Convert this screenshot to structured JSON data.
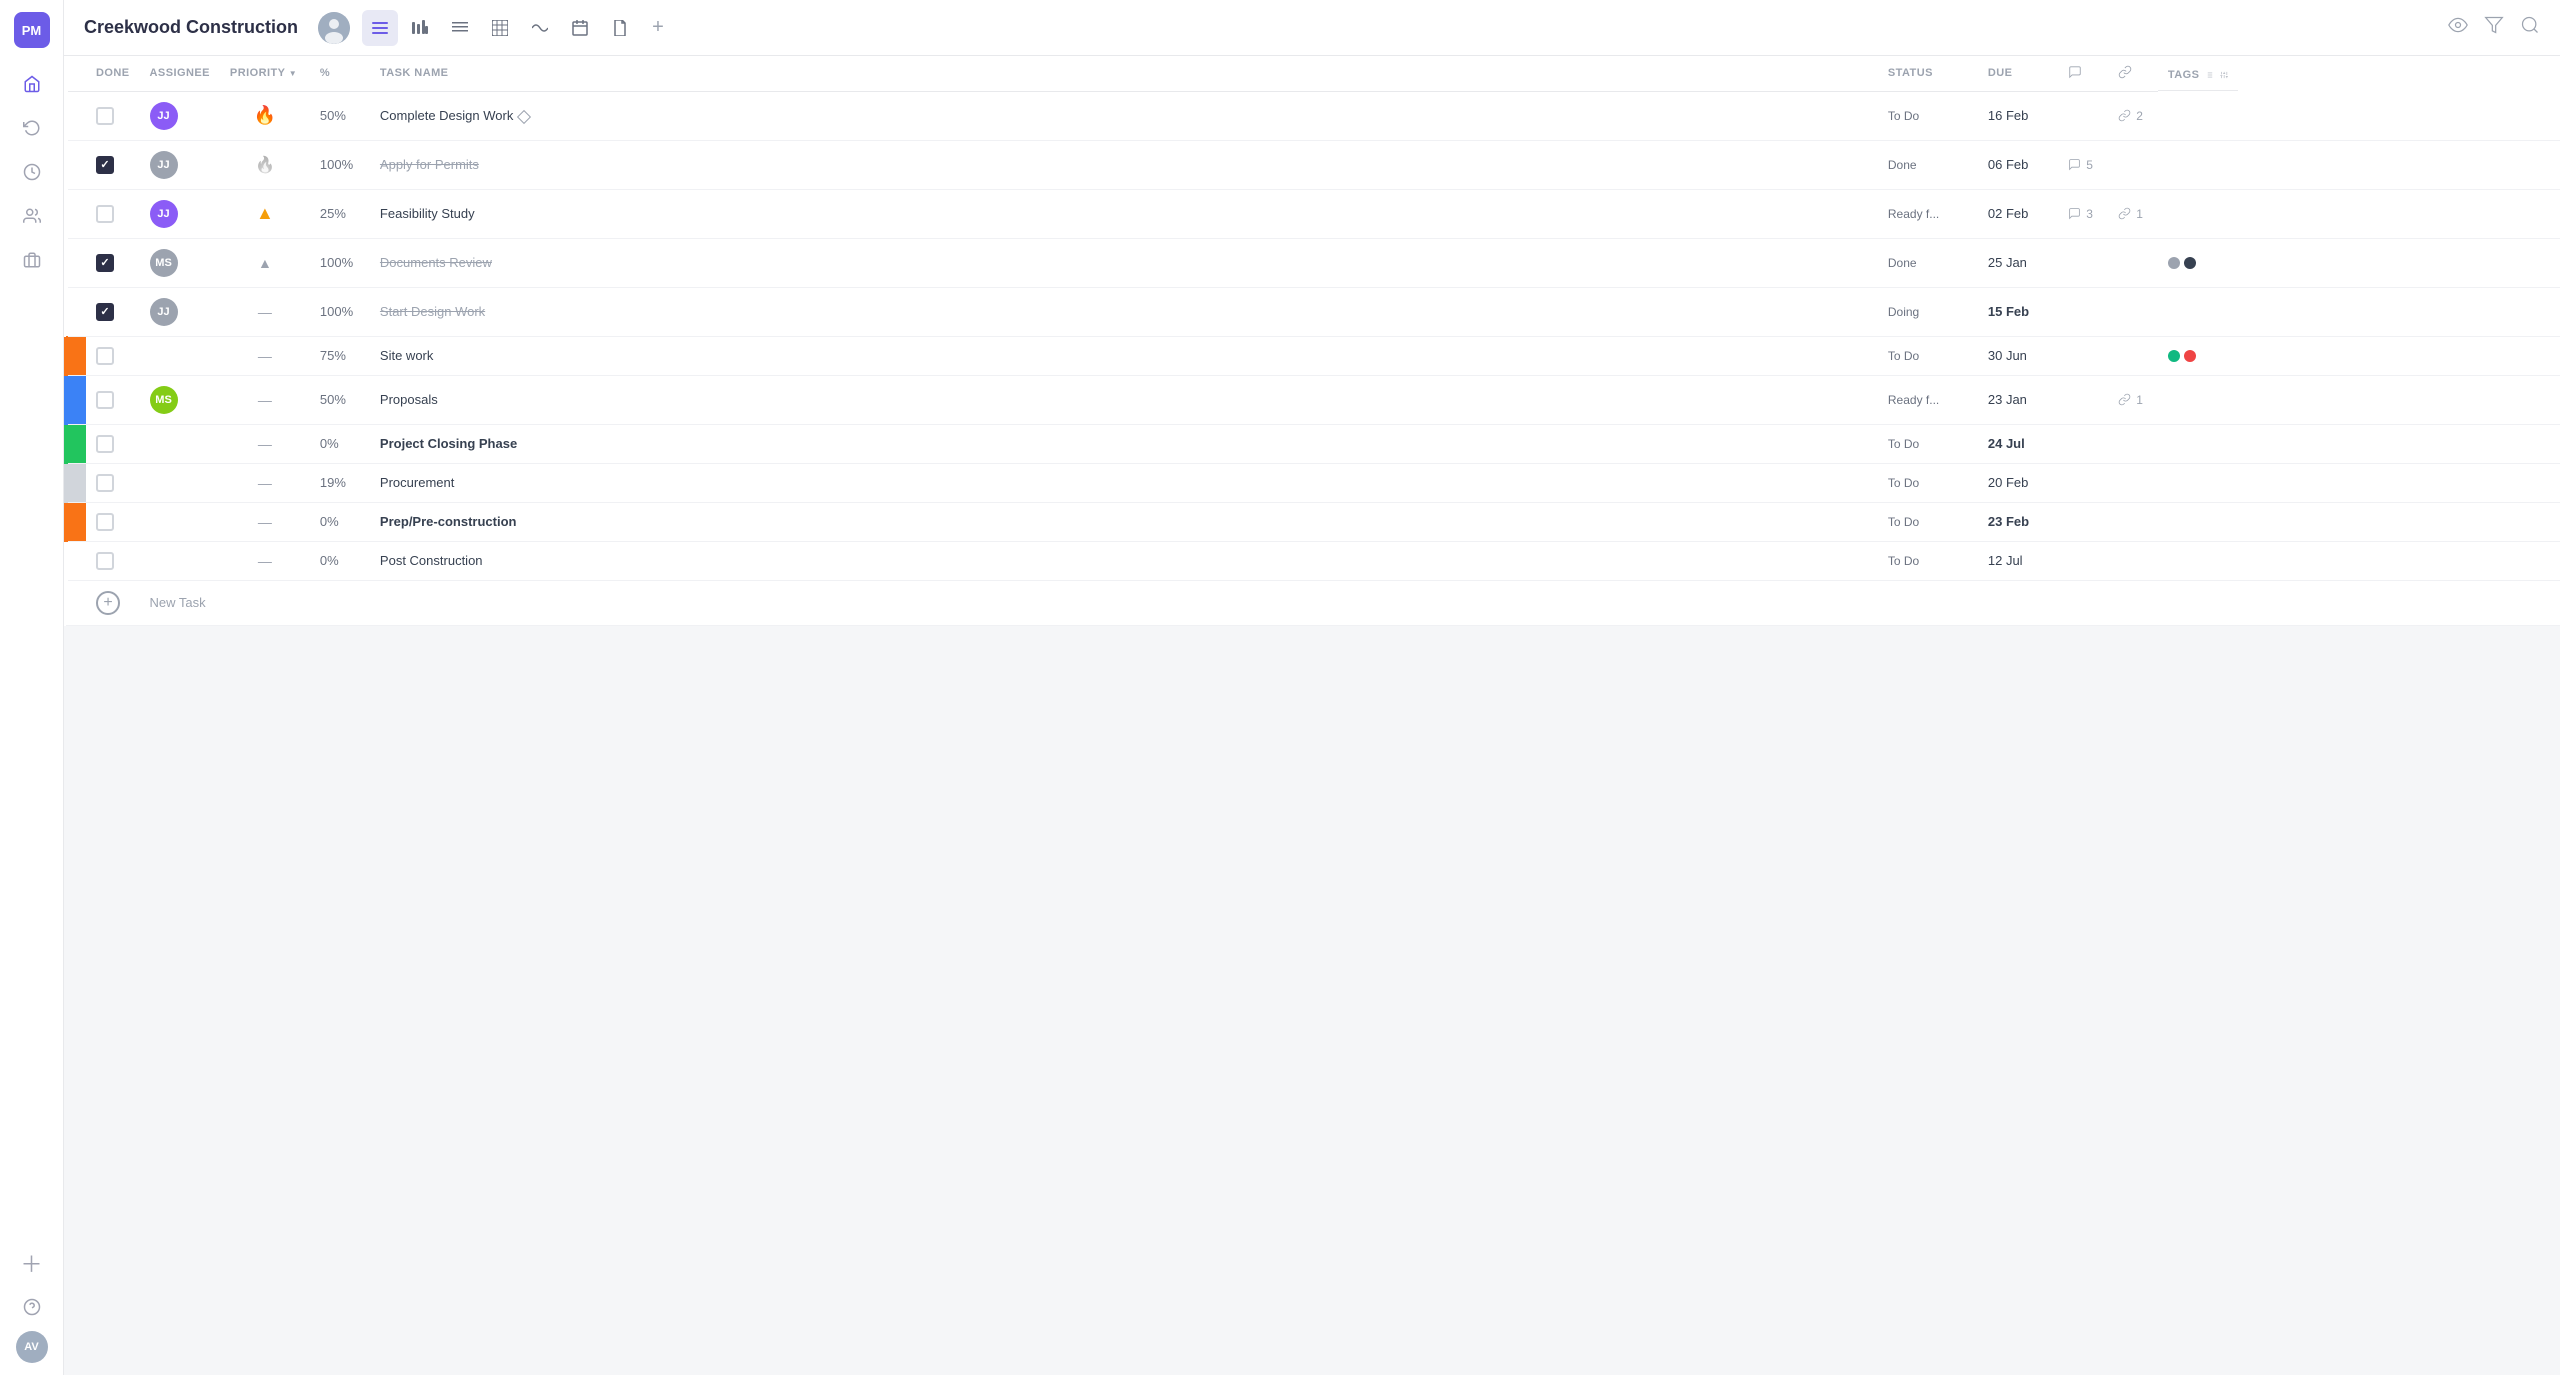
{
  "app": {
    "logo": "PM",
    "title": "Creekwood Construction"
  },
  "header": {
    "title": "Creekwood Construction",
    "avatar_text": "AV",
    "nav_items": [
      {
        "id": "list",
        "icon": "☰",
        "active": true
      },
      {
        "id": "bar",
        "icon": "⬛",
        "active": false
      },
      {
        "id": "menu",
        "icon": "≡",
        "active": false
      },
      {
        "id": "table",
        "icon": "▦",
        "active": false
      },
      {
        "id": "wave",
        "icon": "∿",
        "active": false
      },
      {
        "id": "calendar",
        "icon": "📅",
        "active": false
      },
      {
        "id": "file",
        "icon": "📄",
        "active": false
      },
      {
        "id": "plus",
        "icon": "+",
        "active": false
      }
    ],
    "right_icons": [
      "👁",
      "⛁",
      "⌕"
    ]
  },
  "columns": {
    "done": "DONE",
    "assignee": "ASSIGNEE",
    "priority": "PRIORITY",
    "percent": "%",
    "task_name": "TASK NAME",
    "status": "STATUS",
    "due": "DUE",
    "tags": "TAGS"
  },
  "tasks": [
    {
      "id": 1,
      "done": false,
      "assignee": "JJ",
      "assignee_color": "#8b5cf6",
      "priority": "fire_high",
      "percent": "50%",
      "task_name": "Complete Design Work",
      "has_diamond": true,
      "status": "To Do",
      "due": "16 Feb",
      "due_bold": false,
      "comment_count": null,
      "link_count": 2,
      "tags": [],
      "strikethrough": false,
      "bold": false,
      "bar_color": null
    },
    {
      "id": 2,
      "done": true,
      "assignee": "JJ",
      "assignee_color": "#9ca3af",
      "priority": "fire_low",
      "percent": "100%",
      "task_name": "Apply for Permits",
      "has_diamond": false,
      "status": "Done",
      "due": "06 Feb",
      "due_bold": false,
      "comment_count": 5,
      "link_count": null,
      "tags": [],
      "strikethrough": true,
      "bold": false,
      "bar_color": null
    },
    {
      "id": 3,
      "done": false,
      "assignee": "JJ",
      "assignee_color": "#8b5cf6",
      "priority": "arrow_up",
      "percent": "25%",
      "task_name": "Feasibility Study",
      "has_diamond": false,
      "status": "Ready f...",
      "due": "02 Feb",
      "due_bold": false,
      "comment_count": 3,
      "link_count": 1,
      "tags": [],
      "strikethrough": false,
      "bold": false,
      "bar_color": null
    },
    {
      "id": 4,
      "done": true,
      "assignee": "MS",
      "assignee_color": "#9ca3af",
      "priority": "arrow_mid",
      "percent": "100%",
      "task_name": "Documents Review",
      "has_diamond": false,
      "status": "Done",
      "due": "25 Jan",
      "due_bold": false,
      "comment_count": null,
      "link_count": null,
      "tags": [
        "gray",
        "dark"
      ],
      "strikethrough": true,
      "bold": false,
      "bar_color": null
    },
    {
      "id": 5,
      "done": true,
      "assignee": "JJ",
      "assignee_color": "#9ca3af",
      "priority": "dash",
      "percent": "100%",
      "task_name": "Start Design Work",
      "has_diamond": false,
      "status": "Doing",
      "due": "15 Feb",
      "due_bold": true,
      "comment_count": null,
      "link_count": null,
      "tags": [],
      "strikethrough": true,
      "bold": false,
      "bar_color": null
    },
    {
      "id": 6,
      "done": false,
      "assignee": null,
      "assignee_color": null,
      "priority": "dash_wide",
      "percent": "75%",
      "task_name": "Site work",
      "has_diamond": false,
      "status": "To Do",
      "due": "30 Jun",
      "due_bold": false,
      "comment_count": null,
      "link_count": null,
      "tags": [
        "green",
        "red"
      ],
      "strikethrough": false,
      "bold": false,
      "bar_color": "orange"
    },
    {
      "id": 7,
      "done": false,
      "assignee": "MS",
      "assignee_color": "#84cc16",
      "priority": "dash_wide",
      "percent": "50%",
      "task_name": "Proposals",
      "has_diamond": false,
      "status": "Ready f...",
      "due": "23 Jan",
      "due_bold": false,
      "comment_count": null,
      "link_count": 1,
      "tags": [],
      "strikethrough": false,
      "bold": false,
      "bar_color": "blue"
    },
    {
      "id": 8,
      "done": false,
      "assignee": null,
      "assignee_color": null,
      "priority": "dash_wide",
      "percent": "0%",
      "task_name": "Project Closing Phase",
      "has_diamond": false,
      "status": "To Do",
      "due": "24 Jul",
      "due_bold": true,
      "comment_count": null,
      "link_count": null,
      "tags": [],
      "strikethrough": false,
      "bold": true,
      "bar_color": "green"
    },
    {
      "id": 9,
      "done": false,
      "assignee": null,
      "assignee_color": null,
      "priority": "dash_wide",
      "percent": "19%",
      "task_name": "Procurement",
      "has_diamond": false,
      "status": "To Do",
      "due": "20 Feb",
      "due_bold": false,
      "comment_count": null,
      "link_count": null,
      "tags": [],
      "strikethrough": false,
      "bold": false,
      "bar_color": "gray_light"
    },
    {
      "id": 10,
      "done": false,
      "assignee": null,
      "assignee_color": null,
      "priority": "dash_wide",
      "percent": "0%",
      "task_name": "Prep/Pre-construction",
      "has_diamond": false,
      "status": "To Do",
      "due": "23 Feb",
      "due_bold": true,
      "comment_count": null,
      "link_count": null,
      "tags": [],
      "strikethrough": false,
      "bold": true,
      "bar_color": "orange"
    },
    {
      "id": 11,
      "done": false,
      "assignee": null,
      "assignee_color": null,
      "priority": "dash_wide",
      "percent": "0%",
      "task_name": "Post Construction",
      "has_diamond": false,
      "status": "To Do",
      "due": "12 Jul",
      "due_bold": false,
      "comment_count": null,
      "link_count": null,
      "tags": [],
      "strikethrough": false,
      "bold": false,
      "bar_color": null
    }
  ],
  "new_task_label": "New Task",
  "sidebar_icons": [
    "🏠",
    "🔄",
    "⏱",
    "👥",
    "💼"
  ],
  "bottom_sidebar": [
    "➕",
    "❓"
  ]
}
